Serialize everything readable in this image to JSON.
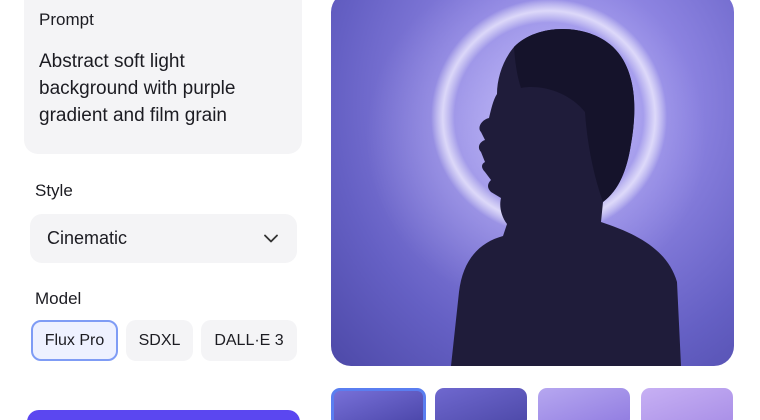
{
  "prompt": {
    "heading": "Prompt",
    "text": "Abstract soft light background with purple gradient and film grain"
  },
  "style": {
    "heading": "Style",
    "selected": "Cinematic"
  },
  "model": {
    "heading": "Model",
    "options": [
      "Flux Pro",
      "SDXL",
      "DALL·E 3"
    ],
    "selected": "Flux Pro"
  },
  "colors": {
    "accent": "#5b47f0",
    "selected_border": "#7f9cf5",
    "panel_bg": "#f4f4f6"
  },
  "preview": {
    "thumbnail_count": 4,
    "selected_thumbnail": 1
  }
}
